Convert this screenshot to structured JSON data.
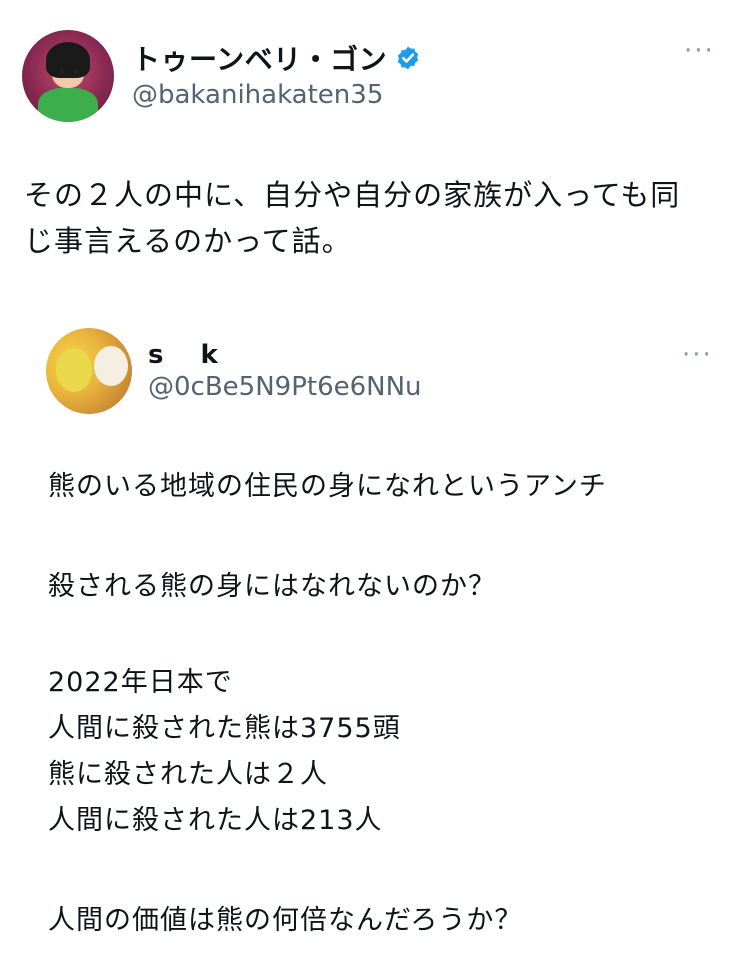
{
  "tweet": {
    "author_name": "トゥーンベリ・ゴン",
    "author_handle": "@bakanihakaten35",
    "more_icon": "···",
    "text": "その２人の中に、自分や自分の家族が入っても同\nじ事言えるのかって話。"
  },
  "quoted_tweet": {
    "author_name": "s k",
    "author_handle": "@0cBe5N9Pt6e6NNu",
    "more_icon": "···",
    "lines": [
      "熊のいる地域の住民の身になれというアンチ",
      "殺される熊の身にはなれないのか？",
      "2022年日本で",
      "人間に殺された熊は3755頭",
      "熊に殺された人は２人",
      "人間に殺された人は213人",
      "人間の価値は熊の何倍なんだろうか？"
    ]
  },
  "colors": {
    "verified_badge": "#1d9bf0",
    "secondary_text": "#536471"
  }
}
